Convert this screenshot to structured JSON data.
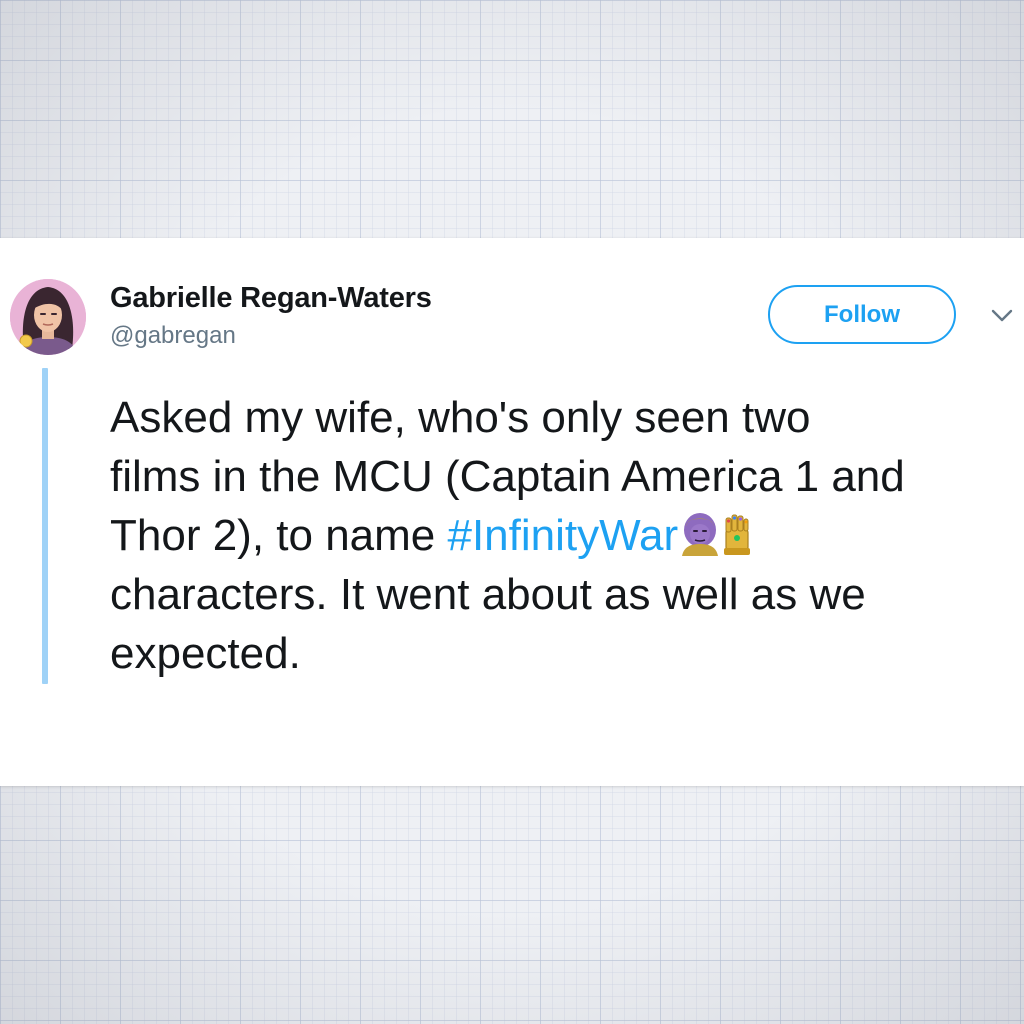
{
  "tweet": {
    "author": {
      "display_name": "Gabrielle Regan-Waters",
      "handle": "@gabregan"
    },
    "follow_label": "Follow",
    "text": {
      "line1": "Asked my wife, who's only seen two",
      "line2": "films in the MCU (Captain America 1 and",
      "line3_prefix": "Thor 2), to name ",
      "hashtag": "#InfinityWar",
      "line4": "characters. It went about as well as we",
      "line5": "expected."
    },
    "emoji": [
      "thanos-face-emoji",
      "infinity-gauntlet-emoji"
    ]
  },
  "colors": {
    "accent": "#1da1f2",
    "thread_line": "#9fd2f7",
    "text": "#14171a",
    "secondary_text": "#657786",
    "background": "#eef0f4"
  },
  "icons": {
    "more_menu": "chevron-down-icon",
    "avatar": "avatar"
  }
}
